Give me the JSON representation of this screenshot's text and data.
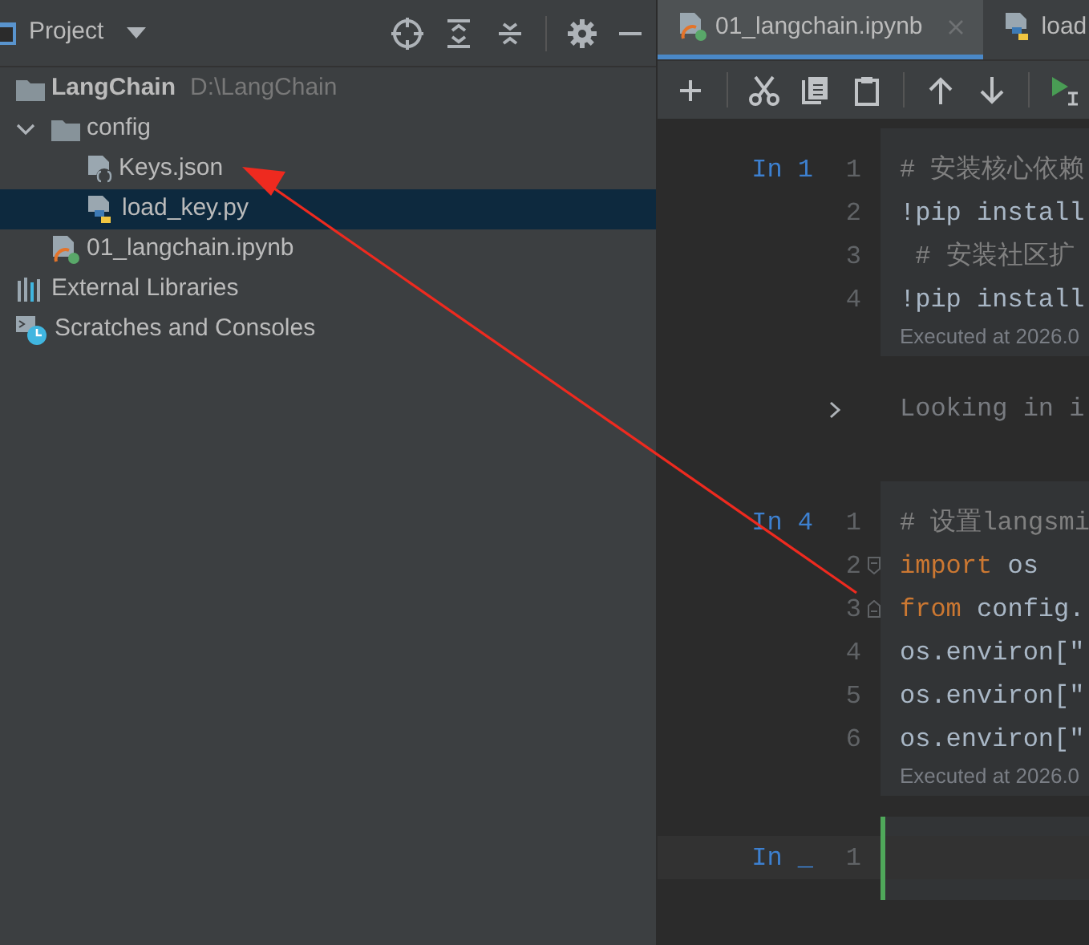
{
  "project_panel": {
    "title": "Project",
    "tree": [
      {
        "label": "LangChain",
        "path": "D:\\LangChain",
        "kind": "folder",
        "selected": false,
        "children": [
          {
            "label": "config",
            "kind": "folder",
            "expanded": true,
            "selected": false,
            "children": [
              {
                "label": "Keys.json",
                "kind": "json",
                "selected": false
              },
              {
                "label": "load_key.py",
                "kind": "python",
                "selected": true
              }
            ]
          },
          {
            "label": "01_langchain.ipynb",
            "kind": "notebook",
            "selected": false
          }
        ]
      },
      {
        "label": "External Libraries",
        "kind": "libraries",
        "selected": false
      },
      {
        "label": "Scratches and Consoles",
        "kind": "scratches",
        "selected": false
      }
    ]
  },
  "tabs": [
    {
      "label": "01_langchain.ipynb",
      "kind": "notebook",
      "selected": true
    },
    {
      "label": "load",
      "kind": "python",
      "selected": false
    }
  ],
  "cells": [
    {
      "prompt": "In 1",
      "active": false,
      "lines": [
        {
          "number": "1",
          "tokens": [
            {
              "kind": "comment",
              "text": "# 安装核心依赖"
            }
          ]
        },
        {
          "number": "2",
          "tokens": [
            {
              "kind": "plain",
              "text": "!pip install"
            }
          ]
        },
        {
          "number": "3",
          "tokens": [
            {
              "kind": "comment",
              "text": " # 安装社区扩"
            }
          ]
        },
        {
          "number": "4",
          "tokens": [
            {
              "kind": "plain",
              "text": "!pip install"
            }
          ]
        }
      ],
      "executed": "Executed at 2026.0",
      "output": "Looking in i"
    },
    {
      "prompt": "In 4",
      "active": false,
      "lines": [
        {
          "number": "1",
          "tokens": [
            {
              "kind": "comment",
              "text": "# 设置langsmi"
            }
          ]
        },
        {
          "number": "2",
          "fold_start": true,
          "tokens": [
            {
              "kind": "keyword",
              "text": "import"
            },
            {
              "kind": "plain",
              "text": " os"
            }
          ]
        },
        {
          "number": "3",
          "fold_end": true,
          "tokens": [
            {
              "kind": "keyword",
              "text": "from"
            },
            {
              "kind": "plain",
              "text": " config."
            }
          ]
        },
        {
          "number": "4",
          "tokens": [
            {
              "kind": "plain",
              "text": "os.environ[\""
            }
          ]
        },
        {
          "number": "5",
          "tokens": [
            {
              "kind": "plain",
              "text": "os.environ[\""
            }
          ]
        },
        {
          "number": "6",
          "tokens": [
            {
              "kind": "plain",
              "text": "os.environ[\""
            }
          ]
        }
      ],
      "executed": "Executed at 2026.0"
    },
    {
      "prompt": "In _",
      "active": true,
      "lines": [
        {
          "number": "1",
          "current": true
        }
      ]
    }
  ]
}
